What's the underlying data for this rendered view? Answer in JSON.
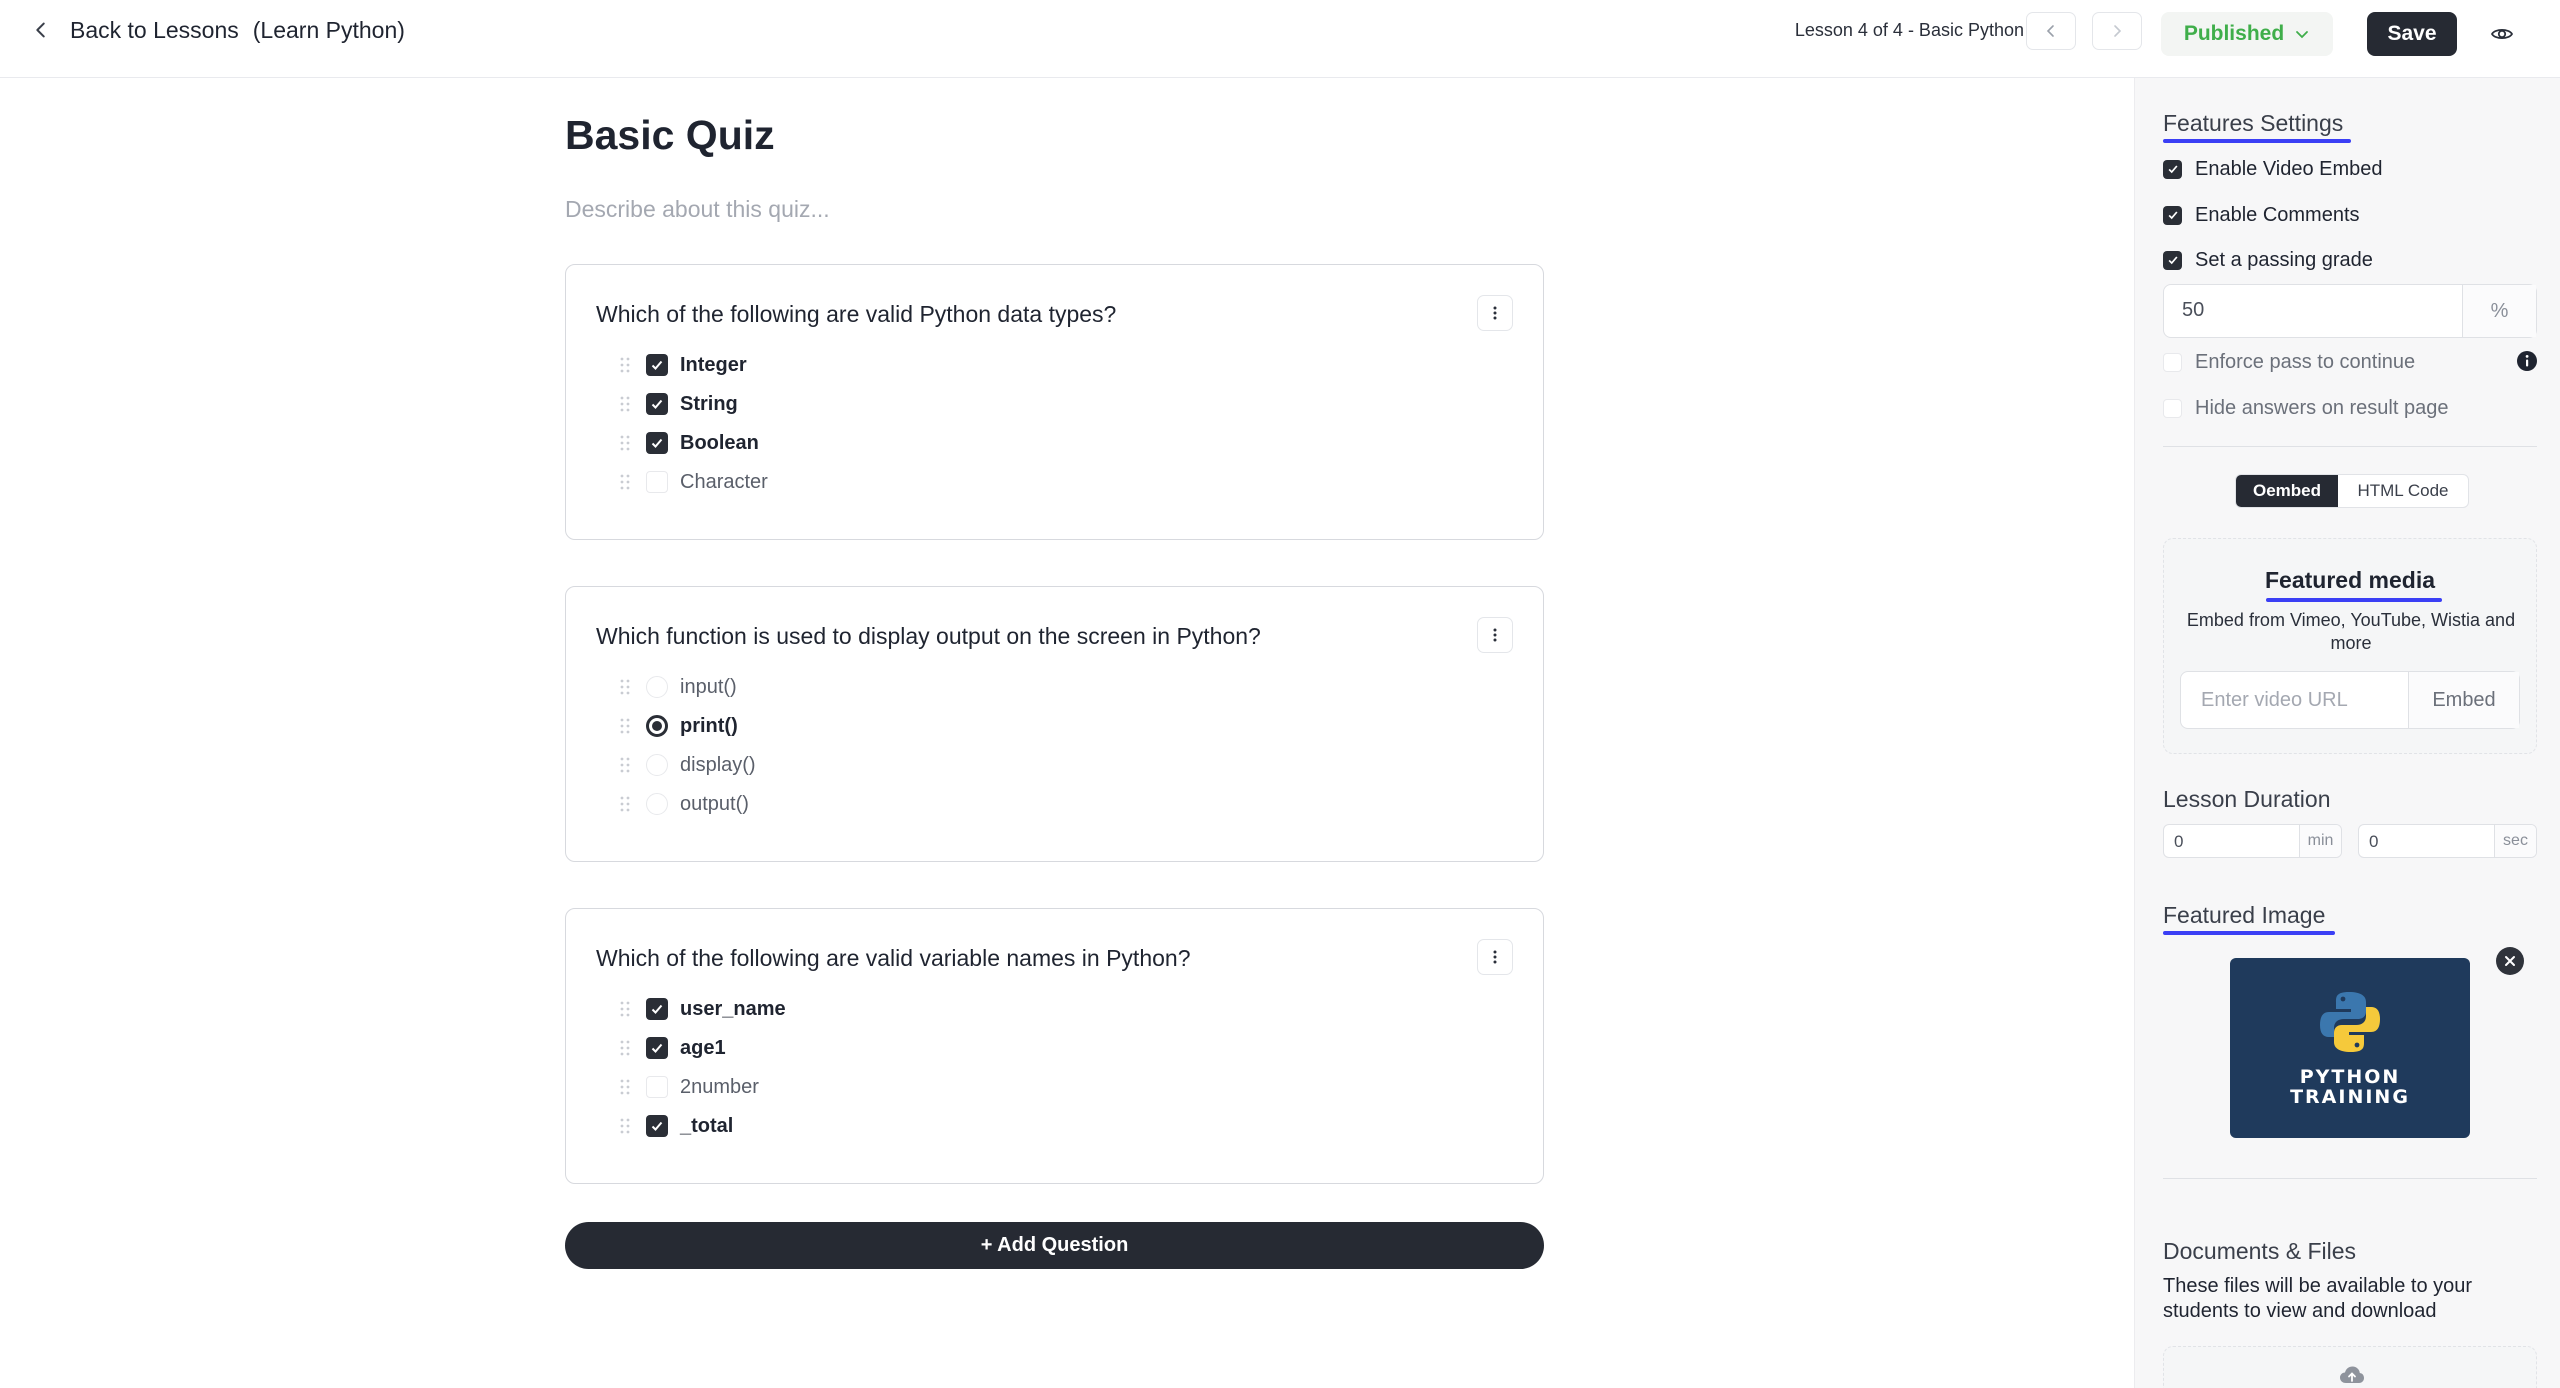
{
  "topbar": {
    "back_label": "Back to Lessons",
    "course_label": "(Learn Python)",
    "lesson_count": "Lesson 4 of 4 - Basic Python",
    "status_label": "Published",
    "save_label": "Save"
  },
  "quiz": {
    "title": "Basic Quiz",
    "description_placeholder": "Describe about this quiz...",
    "add_question_label": "+ Add Question",
    "questions": [
      {
        "text": "Which of the following are valid Python data types?",
        "type": "checkbox",
        "options": [
          {
            "label": "Integer",
            "selected": true
          },
          {
            "label": "String",
            "selected": true
          },
          {
            "label": "Boolean",
            "selected": true
          },
          {
            "label": "Character",
            "selected": false
          }
        ]
      },
      {
        "text": "Which function is used to display output on the screen in Python?",
        "type": "radio",
        "options": [
          {
            "label": "input()",
            "selected": false
          },
          {
            "label": "print()",
            "selected": true
          },
          {
            "label": "display()",
            "selected": false
          },
          {
            "label": "output()",
            "selected": false
          }
        ]
      },
      {
        "text": "Which of the following are valid variable names in Python?",
        "type": "checkbox",
        "options": [
          {
            "label": "user_name",
            "selected": true
          },
          {
            "label": "age1",
            "selected": true
          },
          {
            "label": "2number",
            "selected": false
          },
          {
            "label": "_total",
            "selected": true
          }
        ]
      }
    ]
  },
  "sidebar": {
    "features_title": "Features Settings",
    "enable_video_embed": "Enable Video Embed",
    "enable_comments": "Enable Comments",
    "passing_grade_label": "Set a passing grade",
    "passing_grade_value": "50",
    "passing_grade_unit": "%",
    "enforce_pass": "Enforce pass to continue",
    "hide_answers": "Hide answers on result page",
    "tab_oembed": "Oembed",
    "tab_html": "HTML Code",
    "featured_media_title": "Featured media",
    "featured_media_desc": "Embed from Vimeo, YouTube, Wistia and more",
    "video_url_placeholder": "Enter video URL",
    "embed_label": "Embed",
    "duration_title": "Lesson Duration",
    "duration_min_value": "0",
    "duration_min_unit": "min",
    "duration_sec_value": "0",
    "duration_sec_unit": "sec",
    "featured_image_title": "Featured Image",
    "featured_image_text_line1": "PYTHON",
    "featured_image_text_line2": "TRAINING",
    "docs_title": "Documents & Files",
    "docs_desc": "These files will be available to your students to view and download"
  },
  "colors": {
    "primary_dark": "#262a33",
    "published_green": "#3fae4a",
    "accent_blue": "#3b3ff5"
  }
}
